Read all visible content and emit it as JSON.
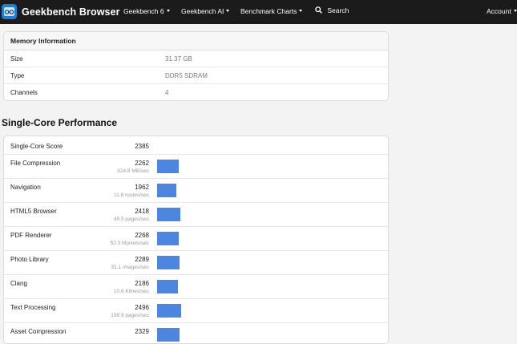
{
  "navbar": {
    "brand": "Geekbench Browser",
    "links": [
      "Geekbench 6",
      "Geekbench AI",
      "Benchmark Charts"
    ],
    "search": "Search",
    "account": "Account"
  },
  "memory": {
    "title": "Memory Information",
    "rows": [
      {
        "name": "Size",
        "value": "31.37 GB"
      },
      {
        "name": "Type",
        "value": "DDR5 SDRAM"
      },
      {
        "name": "Channels",
        "value": "4"
      }
    ]
  },
  "single_core": {
    "title": "Single-Core Performance",
    "score_label": "Single-Core Score",
    "score": "2385",
    "benchmarks": [
      {
        "name": "File Compression",
        "score": "2262",
        "rate": "324.8 MB/sec",
        "bar": 2262
      },
      {
        "name": "Navigation",
        "score": "1962",
        "rate": "11.8 routes/sec",
        "bar": 1962
      },
      {
        "name": "HTML5 Browser",
        "score": "2418",
        "rate": "49.5 pages/sec",
        "bar": 2418
      },
      {
        "name": "PDF Renderer",
        "score": "2268",
        "rate": "52.3 Mpixels/sec",
        "bar": 2268
      },
      {
        "name": "Photo Library",
        "score": "2289",
        "rate": "31.1 images/sec",
        "bar": 2289
      },
      {
        "name": "Clang",
        "score": "2186",
        "rate": "10.6 Klines/sec",
        "bar": 2186
      },
      {
        "name": "Text Processing",
        "score": "2496",
        "rate": "199.9 pages/sec",
        "bar": 2496
      },
      {
        "name": "Asset Compression",
        "score": "2329",
        "rate": "",
        "bar": 2329
      }
    ]
  },
  "colors": {
    "bar": "#4c86e0",
    "navbar": "#1b1b1b",
    "logo": "#1f7fd8"
  }
}
